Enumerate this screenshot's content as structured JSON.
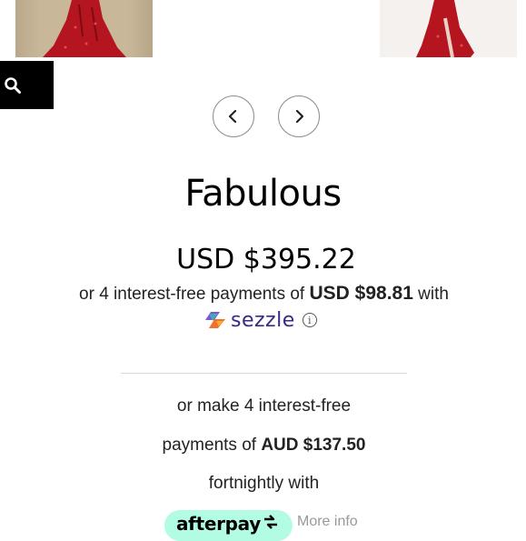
{
  "gallery": {
    "prev_icon": "chevron-left-icon",
    "next_icon": "chevron-right-icon"
  },
  "search": {
    "icon": "search-icon"
  },
  "product": {
    "title": "Fabulous",
    "price": "USD $395.22"
  },
  "sezzle": {
    "text_before": "or 4 interest-free payments of ",
    "amount": "USD $98.81",
    "text_after": " with",
    "brand": "sezzle",
    "info_icon": "info-icon",
    "brand_color": "#382887"
  },
  "afterpay": {
    "line1": "or make 4 interest-free",
    "line2_prefix": "payments of ",
    "amount": "AUD $137.50",
    "line3": "fortnightly with",
    "brand": "afterpay",
    "brand_color": "#b2fce4",
    "more_info": "More info"
  },
  "colors": {
    "dress": "#b5151e",
    "search_bg": "#000000"
  }
}
